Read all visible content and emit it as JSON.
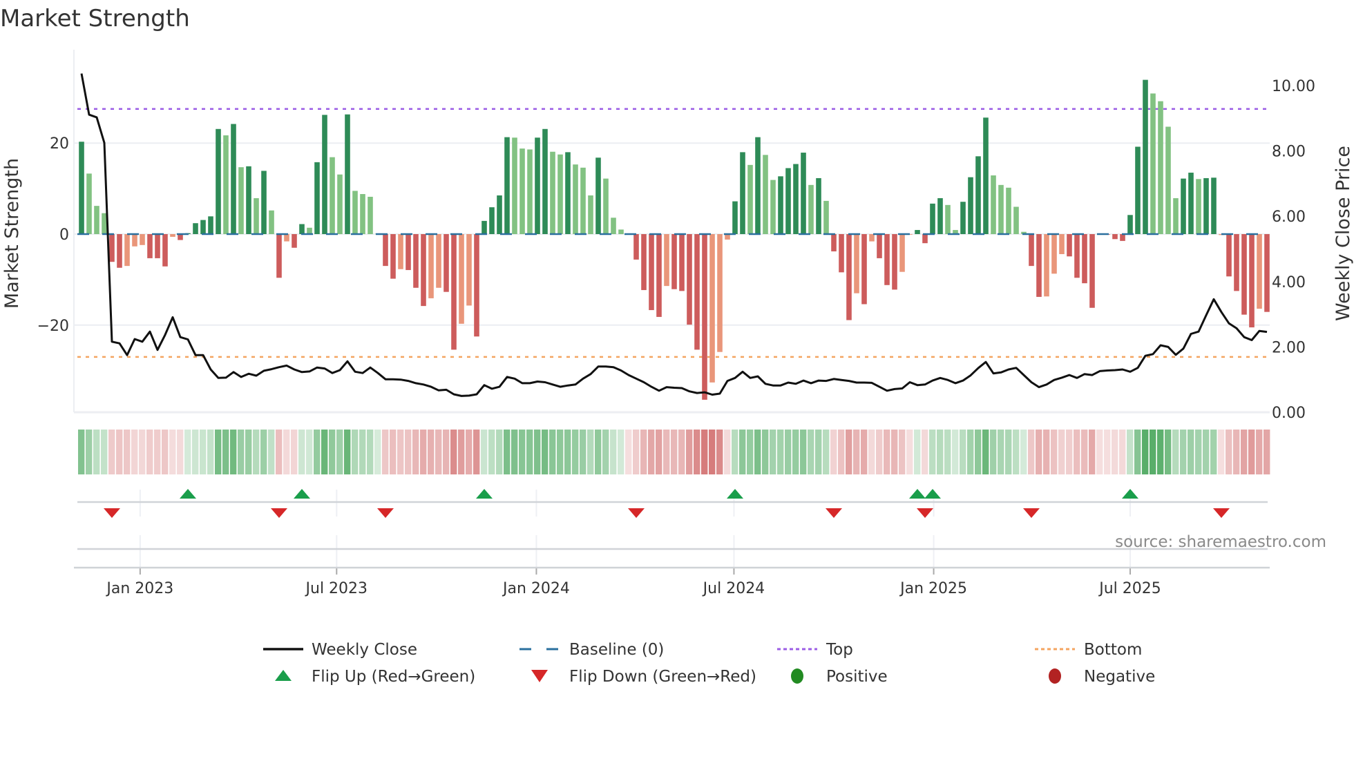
{
  "chart_data": {
    "type": "bar",
    "title": "Market Strength",
    "ylabel_left": "Market Strength",
    "ylabel_right": "Weekly Close Price",
    "ylim_left": [
      -39,
      39
    ],
    "ylim_right": [
      0,
      10.9
    ],
    "yticks_left": [
      {
        "v": 20,
        "label": "20"
      },
      {
        "v": 0,
        "label": "0"
      },
      {
        "v": -20,
        "label": "−20"
      }
    ],
    "yticks_right": [
      {
        "v": 0,
        "label": "0.00"
      },
      {
        "v": 2,
        "label": "2.00"
      },
      {
        "v": 4,
        "label": "4.00"
      },
      {
        "v": 6,
        "label": "6.00"
      },
      {
        "v": 8,
        "label": "8.00"
      },
      {
        "v": 10,
        "label": "10.00"
      }
    ],
    "start_date": "2022-11-08",
    "x_ticks": [
      {
        "date": "2023-01-01",
        "label": "Jan 2023"
      },
      {
        "date": "2023-07-01",
        "label": "Jul 2023"
      },
      {
        "date": "2024-01-01",
        "label": "Jan 2024"
      },
      {
        "date": "2024-07-01",
        "label": "Jul 2024"
      },
      {
        "date": "2025-01-01",
        "label": "Jan 2025"
      },
      {
        "date": "2025-07-01",
        "label": "Jul 2025"
      }
    ],
    "top_level": 27.5,
    "bottom_level": -27,
    "baseline": 0,
    "strength": [
      20.3,
      13.3,
      6.2,
      4.6,
      -6.1,
      -7.4,
      -7.0,
      -2.7,
      -2.4,
      -5.3,
      -5.3,
      -7.1,
      -0.6,
      -1.3,
      0.2,
      2.4,
      3.1,
      3.9,
      23.1,
      21.7,
      24.2,
      14.7,
      14.9,
      7.9,
      13.9,
      5.2,
      -9.6,
      -1.6,
      -3.0,
      2.2,
      1.4,
      15.8,
      26.2,
      16.9,
      13.1,
      26.3,
      9.5,
      8.8,
      8.2,
      0.1,
      -7.0,
      -9.8,
      -7.7,
      -7.9,
      -11.8,
      -15.8,
      -14.1,
      -11.8,
      -12.7,
      -25.4,
      -19.7,
      -15.7,
      -22.5,
      2.9,
      5.9,
      8.5,
      21.3,
      21.2,
      18.8,
      18.6,
      21.2,
      23.1,
      18.1,
      17.5,
      18.0,
      15.3,
      14.6,
      8.5,
      16.8,
      12.2,
      3.6,
      1.0,
      -0.1,
      -5.6,
      -12.3,
      -16.7,
      -18.2,
      -11.4,
      -12.1,
      -12.5,
      -19.9,
      -25.4,
      -36.4,
      -32.6,
      -25.9,
      -1.2,
      7.2,
      18.0,
      15.2,
      21.3,
      17.4,
      11.9,
      12.7,
      14.5,
      15.4,
      17.9,
      10.8,
      12.3,
      7.3,
      -3.8,
      -8.4,
      -18.9,
      -13.0,
      -15.4,
      -1.6,
      -5.3,
      -11.2,
      -12.2,
      -8.3,
      -0.1,
      0.9,
      -2.0,
      6.7,
      7.9,
      6.4,
      0.9,
      7.1,
      12.5,
      17.1,
      25.6,
      12.9,
      10.8,
      10.2,
      6.0,
      0.5,
      -7.0,
      -13.8,
      -13.7,
      -8.7,
      -4.4,
      -4.9,
      -9.6,
      -10.8,
      -16.2,
      -0.1,
      -0.1,
      -1.1,
      -1.5,
      4.2,
      19.2,
      33.9,
      30.9,
      29.2,
      23.6,
      7.9,
      12.2,
      13.5,
      12.1,
      12.3,
      12.4,
      -0.2,
      -9.3,
      -12.5,
      -17.7,
      -20.5,
      -16.4,
      -17.1
    ],
    "strength_shade": "DLLLRRSSSRRRSRDDDDDLDLDLDLRSRDLDDLLDLLLLRRSRRRSSRRSSRDDDDLLLDDLLDLLLDLLLSRRRRSRRRRRSSSDDLDLLDDDDLDLRRRSRSRRRSSDRDDLLDDDDLLLLLRRSSSRRRRRRRRDDDLLLLDDLDDSRRRRSR",
    "weekly_close": [
      10.37,
      9.11,
      9.03,
      8.25,
      2.16,
      2.11,
      1.75,
      2.24,
      2.16,
      2.47,
      1.91,
      2.37,
      2.91,
      2.3,
      2.23,
      1.75,
      1.75,
      1.31,
      1.05,
      1.06,
      1.23,
      1.08,
      1.18,
      1.12,
      1.27,
      1.32,
      1.38,
      1.43,
      1.31,
      1.23,
      1.25,
      1.37,
      1.34,
      1.2,
      1.29,
      1.56,
      1.24,
      1.2,
      1.37,
      1.2,
      1.01,
      1.01,
      1.0,
      0.96,
      0.89,
      0.85,
      0.78,
      0.67,
      0.69,
      0.55,
      0.5,
      0.51,
      0.55,
      0.83,
      0.72,
      0.78,
      1.08,
      1.03,
      0.89,
      0.89,
      0.94,
      0.92,
      0.85,
      0.78,
      0.82,
      0.85,
      1.03,
      1.17,
      1.4,
      1.4,
      1.38,
      1.28,
      1.14,
      1.03,
      0.92,
      0.78,
      0.66,
      0.77,
      0.75,
      0.74,
      0.64,
      0.59,
      0.61,
      0.54,
      0.57,
      0.96,
      1.05,
      1.24,
      1.05,
      1.1,
      0.87,
      0.82,
      0.82,
      0.91,
      0.87,
      0.97,
      0.89,
      0.97,
      0.96,
      1.02,
      0.99,
      0.96,
      0.91,
      0.91,
      0.9,
      0.78,
      0.66,
      0.71,
      0.73,
      0.92,
      0.83,
      0.85,
      0.97,
      1.05,
      0.99,
      0.89,
      0.97,
      1.13,
      1.35,
      1.54,
      1.19,
      1.22,
      1.31,
      1.36,
      1.14,
      0.92,
      0.77,
      0.85,
      0.99,
      1.06,
      1.14,
      1.05,
      1.17,
      1.14,
      1.26,
      1.28,
      1.29,
      1.31,
      1.24,
      1.36,
      1.73,
      1.78,
      2.05,
      2.0,
      1.76,
      1.95,
      2.4,
      2.47,
      2.97,
      3.46,
      3.07,
      2.72,
      2.57,
      2.3,
      2.21,
      2.49,
      2.46
    ],
    "flip_up_weeks": [
      14,
      29,
      53,
      86,
      110,
      112,
      138
    ],
    "flip_down_weeks": [
      4,
      26,
      40,
      73,
      99,
      111,
      125,
      150
    ],
    "legend": [
      {
        "key": "weekly_close",
        "label": "Weekly Close"
      },
      {
        "key": "baseline",
        "label": "Baseline (0)"
      },
      {
        "key": "top",
        "label": "Top"
      },
      {
        "key": "bottom",
        "label": "Bottom"
      },
      {
        "key": "flip_up",
        "label": "Flip Up (Red→Green)"
      },
      {
        "key": "flip_down",
        "label": "Flip Down (Green→Red)"
      },
      {
        "key": "positive",
        "label": "Positive"
      },
      {
        "key": "negative",
        "label": "Negative"
      }
    ],
    "legend_placement": "bottom-center",
    "source": "source: sharemaestro.com"
  },
  "colors": {
    "dark_green": "#2e8b57",
    "light_green": "#82c282",
    "red": "#cd5c5c",
    "salmon": "#e9967a",
    "line": "#111111",
    "baseline": "#2a6f9e",
    "top": "#9b5de5",
    "bottom": "#f4a460",
    "flip_up": "#1a9e4b",
    "flip_down": "#d62728",
    "positive": "#228b22",
    "negative": "#b22222",
    "grid": "#eceef2"
  }
}
